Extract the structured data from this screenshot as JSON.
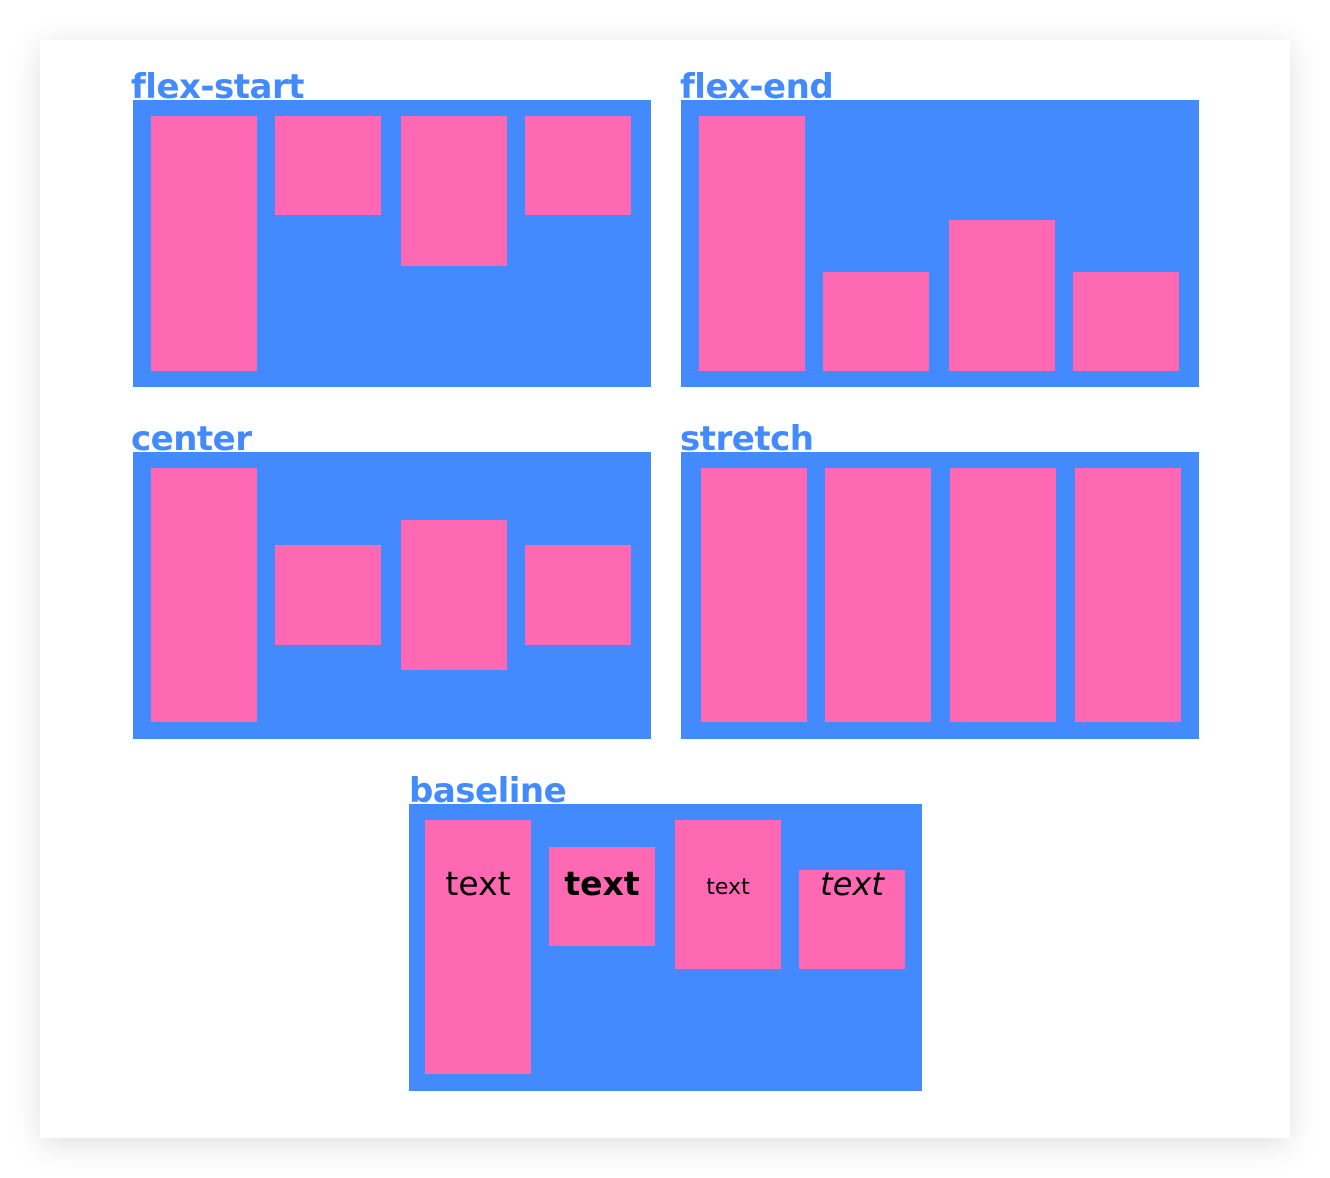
{
  "colors": {
    "container": "#448aff",
    "item": "#ff69b4",
    "label": "#448aff",
    "card": "#ffffff"
  },
  "panels": {
    "flex_start": {
      "label": "flex-start"
    },
    "flex_end": {
      "label": "flex-end"
    },
    "center": {
      "label": "center"
    },
    "stretch": {
      "label": "stretch"
    },
    "baseline": {
      "label": "baseline",
      "items": [
        {
          "text": "text"
        },
        {
          "text": "text"
        },
        {
          "text": "text"
        },
        {
          "text": "text"
        }
      ]
    }
  }
}
